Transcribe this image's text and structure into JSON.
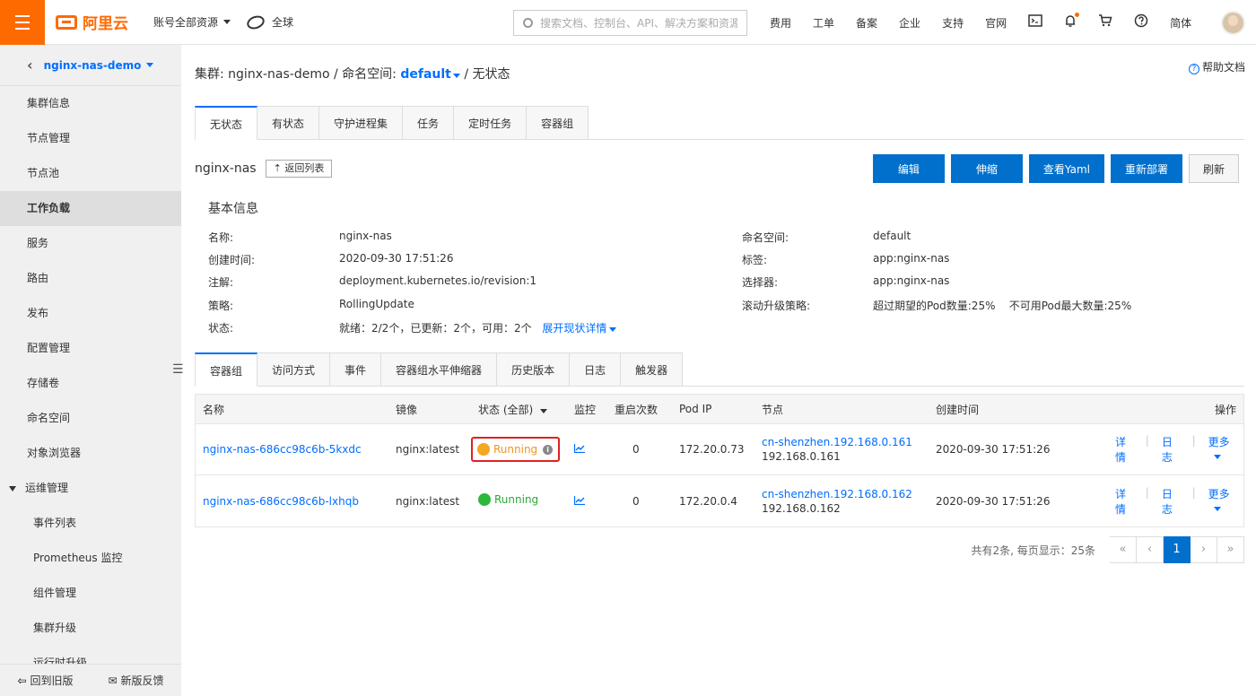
{
  "topbar": {
    "logo_text": "阿里云",
    "account_resources": "账号全部资源",
    "region": "全球",
    "search_placeholder": "搜索文档、控制台、API、解决方案和资源",
    "links": [
      "费用",
      "工单",
      "备案",
      "企业",
      "支持",
      "官网"
    ],
    "language": "简体"
  },
  "sidebar": {
    "cluster_name": "nginx-nas-demo",
    "items": [
      {
        "label": "集群信息"
      },
      {
        "label": "节点管理"
      },
      {
        "label": "节点池"
      },
      {
        "label": "工作负载"
      },
      {
        "label": "服务"
      },
      {
        "label": "路由"
      },
      {
        "label": "发布"
      },
      {
        "label": "配置管理"
      },
      {
        "label": "存储卷"
      },
      {
        "label": "命名空间"
      },
      {
        "label": "对象浏览器"
      }
    ],
    "group_label": "运维管理",
    "sub_items": [
      "事件列表",
      "Prometheus 监控",
      "组件管理",
      "集群升级",
      "运行时升级"
    ],
    "footer_back": "回到旧版",
    "footer_feedback": "新版反馈"
  },
  "breadcrumb": {
    "cluster_label": "集群:",
    "cluster_value": "nginx-nas-demo",
    "sep": "/",
    "ns_label": "命名空间:",
    "ns_value": "default",
    "last": "无状态"
  },
  "help_doc": "帮助文档",
  "workload_tabs": [
    "无状态",
    "有状态",
    "守护进程集",
    "任务",
    "定时任务",
    "容器组"
  ],
  "deployment": {
    "name": "nginx-nas",
    "back_button": "返回列表",
    "buttons": {
      "edit": "编辑",
      "scale": "伸缩",
      "yaml": "查看Yaml",
      "redeploy": "重新部署",
      "refresh": "刷新"
    }
  },
  "basic_info": {
    "title": "基本信息",
    "rows": [
      {
        "k1": "名称:",
        "v1": "nginx-nas",
        "k2": "命名空间:",
        "v2": "default"
      },
      {
        "k1": "创建时间:",
        "v1": "2020-09-30 17:51:26",
        "k2": "标签:",
        "v2": "app:nginx-nas"
      },
      {
        "k1": "注解:",
        "v1": "deployment.kubernetes.io/revision:1",
        "k2": "选择器:",
        "v2": "app:nginx-nas"
      },
      {
        "k1": "策略:",
        "v1": "RollingUpdate",
        "k2": "滚动升级策略:",
        "v2": "超过期望的Pod数量:25%    不可用Pod最大数量:25%"
      }
    ],
    "status_label": "状态:",
    "status_value": "就绪：2/2个，已更新：2个，可用：2个",
    "status_link": "展开现状详情"
  },
  "detail_tabs": [
    "容器组",
    "访问方式",
    "事件",
    "容器组水平伸缩器",
    "历史版本",
    "日志",
    "触发器"
  ],
  "pod_table": {
    "headers": {
      "name": "名称",
      "image": "镜像",
      "status": "状态 (全部)",
      "monitor": "监控",
      "restarts": "重启次数",
      "pod_ip": "Pod IP",
      "node": "节点",
      "created": "创建时间",
      "ops": "操作"
    },
    "rows": [
      {
        "name": "nginx-nas-686cc98c6b-5kxdc",
        "image": "nginx:latest",
        "status": "Running",
        "restarts": "0",
        "pod_ip": "172.20.0.73",
        "node_link": "cn-shenzhen.192.168.0.161",
        "node_ip": "192.168.0.161",
        "created": "2020-09-30 17:51:26"
      },
      {
        "name": "nginx-nas-686cc98c6b-lxhqb",
        "image": "nginx:latest",
        "status": "Running",
        "restarts": "0",
        "pod_ip": "172.20.0.4",
        "node_link": "cn-shenzhen.192.168.0.162",
        "node_ip": "192.168.0.162",
        "created": "2020-09-30 17:51:26"
      }
    ],
    "ops": {
      "details": "详情",
      "logs": "日志",
      "more": "更多",
      "sep": "|"
    }
  },
  "pagination": {
    "summary": "共有2条, 每页显示：25条",
    "first": "«",
    "prev": "‹",
    "current": "1",
    "next": "›",
    "last": "»"
  }
}
